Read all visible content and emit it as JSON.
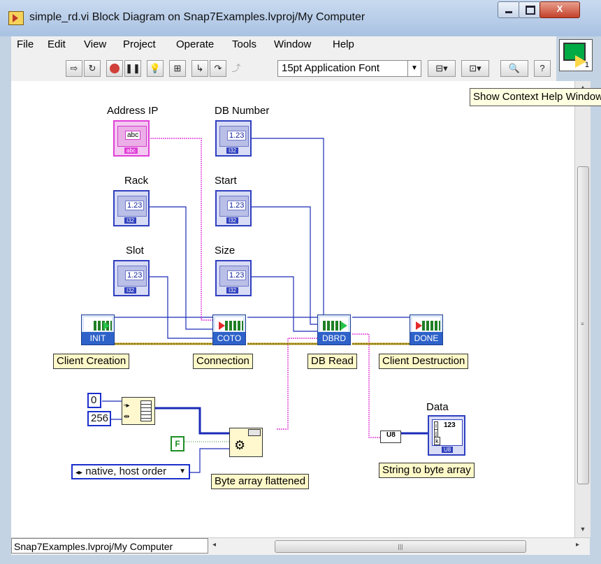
{
  "window": {
    "title": "simple_rd.vi Block Diagram on Snap7Examples.lvproj/My Computer",
    "minimize": "–",
    "maximize": "□",
    "close": "X"
  },
  "menu": [
    "File",
    "Edit",
    "View",
    "Project",
    "Operate",
    "Tools",
    "Window",
    "Help"
  ],
  "toolbar": {
    "font_select": "15pt Application Font",
    "tooltip": "Show Context Help Window"
  },
  "controls": {
    "address_ip": {
      "label": "Address IP",
      "value": "abc",
      "tag": "abc"
    },
    "db_number": {
      "label": "DB Number",
      "value": "1.23",
      "tag": "I32"
    },
    "rack": {
      "label": "Rack",
      "value": "1.23",
      "tag": "I32"
    },
    "start": {
      "label": "Start",
      "value": "1.23",
      "tag": "I32"
    },
    "slot": {
      "label": "Slot",
      "value": "1.23",
      "tag": "I32"
    },
    "size": {
      "label": "Size",
      "value": "1.23",
      "tag": "I32"
    }
  },
  "subvis": {
    "init": {
      "name": "INIT",
      "caption": "Client Creation"
    },
    "coto": {
      "name": "COTO",
      "caption": "Connection"
    },
    "dbrd": {
      "name": "DBRD",
      "caption": "DB Read"
    },
    "done": {
      "name": "DONE",
      "caption": "Client Destruction"
    }
  },
  "constants": {
    "zero": "0",
    "count": "256",
    "bool_false": "F",
    "byte_order": "native, host order"
  },
  "nodes": {
    "flatten_caption": "Byte array flattened",
    "convert_caption": "String to byte array",
    "convert_tag": "U8",
    "indicator_label": "Data",
    "indicator_value": "123",
    "indicator_tag": "U8"
  },
  "status": {
    "context": "Snap7Examples.lvproj/My Computer"
  }
}
